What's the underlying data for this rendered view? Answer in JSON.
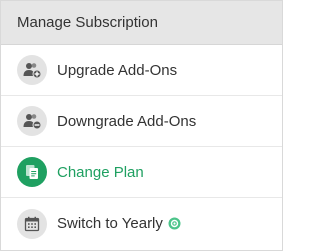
{
  "header": {
    "title": "Manage Subscription"
  },
  "menu": {
    "items": [
      {
        "label": "Upgrade Add-Ons",
        "icon": "users-plus-icon",
        "active": false
      },
      {
        "label": "Downgrade Add-Ons",
        "icon": "users-minus-icon",
        "active": false
      },
      {
        "label": "Change Plan",
        "icon": "copy-documents-icon",
        "active": true
      },
      {
        "label": "Switch to Yearly",
        "icon": "calendar-icon",
        "active": false,
        "badge_icon": "refresh-badge-icon"
      }
    ]
  },
  "colors": {
    "accent": "#1fa061",
    "header_bg": "#e6e6e6",
    "icon_bg": "#e3e3e3",
    "text": "#333333"
  }
}
